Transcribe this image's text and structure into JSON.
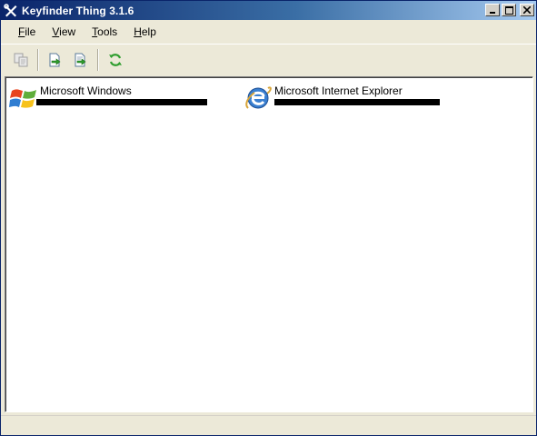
{
  "window": {
    "title": "Keyfinder Thing 3.1.6"
  },
  "menubar": {
    "items": [
      {
        "label_first": "F",
        "label_rest": "ile"
      },
      {
        "label_first": "V",
        "label_rest": "iew"
      },
      {
        "label_first": "T",
        "label_rest": "ools"
      },
      {
        "label_first": "H",
        "label_rest": "elp"
      }
    ]
  },
  "toolbar": {
    "buttons": [
      {
        "icon": "copy-icon",
        "enabled": false
      },
      {
        "icon": "export-icon",
        "enabled": true
      },
      {
        "icon": "export-all-icon",
        "enabled": true
      },
      {
        "icon": "refresh-icon",
        "enabled": true
      }
    ]
  },
  "products": [
    {
      "name": "Microsoft Windows",
      "icon": "windows-logo-icon",
      "key_redacted": true
    },
    {
      "name": "Microsoft Internet Explorer",
      "icon": "internet-explorer-icon",
      "key_redacted": true
    }
  ],
  "status": {
    "text": ""
  },
  "colors": {
    "title_start": "#0a246a",
    "title_end": "#a6caf0",
    "redaction": "#000000"
  }
}
